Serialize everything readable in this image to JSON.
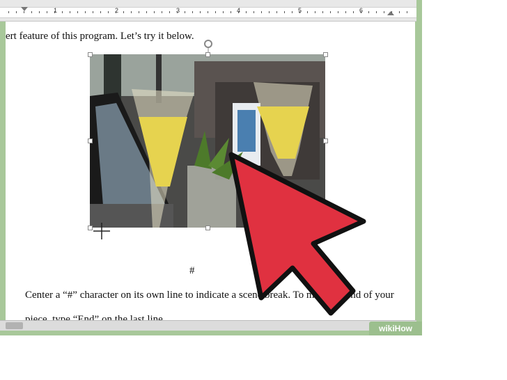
{
  "ruler": {
    "numbers": [
      "1",
      "2",
      "3",
      "4",
      "5",
      "6"
    ]
  },
  "document": {
    "line1": "ert feature of this program.  Let’s try it below.",
    "scene_break": "#",
    "para_line1": "Center a “#” character on its own line to indicate a scene break. To mark the end of your",
    "para_line2": "piece, type “End” on the last line."
  },
  "branding": {
    "watermark": "wikiHow"
  },
  "colors": {
    "frame": "#a8c89a",
    "arrow": "#e03140"
  }
}
